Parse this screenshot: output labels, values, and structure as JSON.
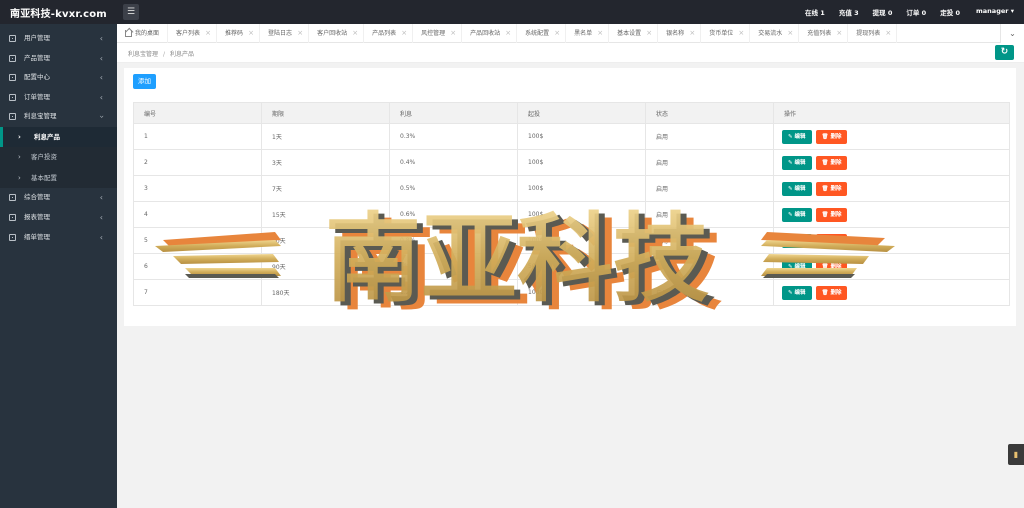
{
  "header": {
    "title": "南亚科技-kvxr.com",
    "stats": [
      "在线 1",
      "充值 3",
      "提现 0",
      "订单 0",
      "定投 0"
    ],
    "user": "manager"
  },
  "sidebar": {
    "items": [
      {
        "label": "用户管理",
        "open": false
      },
      {
        "label": "产品管理",
        "open": false
      },
      {
        "label": "配置中心",
        "open": false
      },
      {
        "label": "订单管理",
        "open": false
      },
      {
        "label": "利息宝管理",
        "open": true
      }
    ],
    "subitems": [
      {
        "label": "利息产品",
        "active": true
      },
      {
        "label": "客户投资",
        "active": false
      },
      {
        "label": "基本配置",
        "active": false
      }
    ],
    "items_after": [
      {
        "label": "综合管理"
      },
      {
        "label": "报表管理"
      },
      {
        "label": "缙单管理"
      }
    ]
  },
  "tabs": [
    "我的桌面",
    "客户列表",
    "推荐码",
    "登陆日志",
    "客户回收站",
    "产品列表",
    "风控管理",
    "产品回收站",
    "系统配置",
    "黑名单",
    "基本设置",
    "银名称",
    "货币单位",
    "交易流水",
    "充值列表",
    "提现列表"
  ],
  "breadcrumb": {
    "parent": "利息宝管理",
    "sep": "/",
    "current": "利息产品"
  },
  "toolbar": {
    "add_label": "添加"
  },
  "table": {
    "headers": [
      "编号",
      "期限",
      "利息",
      "起投",
      "状态",
      "操作"
    ],
    "rows": [
      [
        "1",
        "1天",
        "0.3%",
        "100$",
        "启用"
      ],
      [
        "2",
        "3天",
        "0.4%",
        "100$",
        "启用"
      ],
      [
        "3",
        "7天",
        "0.5%",
        "100$",
        "启用"
      ],
      [
        "4",
        "15天",
        "0.6%",
        "100$",
        "启用"
      ],
      [
        "5",
        "30天",
        "0.8%",
        "100$",
        "启用"
      ],
      [
        "6",
        "90天",
        "1%",
        "500$",
        "启用"
      ],
      [
        "7",
        "180天",
        "1.2%",
        "1000$",
        "启用"
      ]
    ],
    "edit_label": "编辑",
    "delete_label": "删除"
  },
  "watermark": {
    "text": "南亚科技",
    "colors": {
      "gold": "#d9b864",
      "shadow": "#5a5a52",
      "orange": "#e8853c"
    }
  },
  "colors": {
    "teal": "#009688",
    "blue": "#1e9fff",
    "orange": "#ff5722",
    "header": "#23262e",
    "sidebar": "#28333e"
  }
}
